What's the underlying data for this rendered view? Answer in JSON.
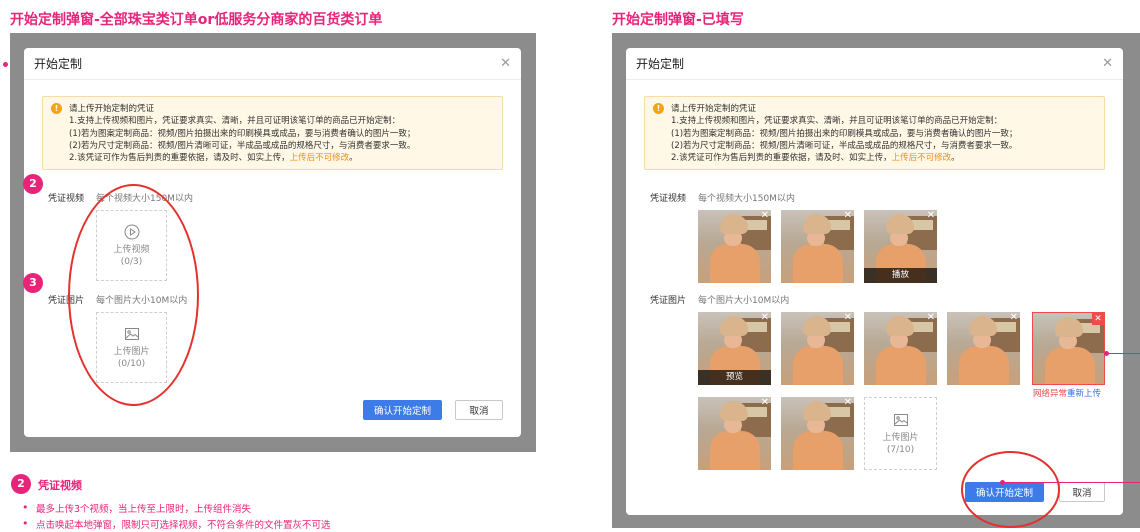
{
  "left_section": {
    "title": "开始定制弹窗-全部珠宝类订单or低服务分商家的百货类订单",
    "modal": {
      "title": "开始定制",
      "notice": {
        "title": "请上传开始定制的凭证",
        "line1": "1.支持上传视频和图片，凭证要求真实、清晰，并且可证明该笔订单的商品已开始定制：",
        "line2": "(1)若为图案定制商品：视频/图片拍摄出来的印刷模具或成品，要与消费者确认的图片一致；",
        "line3": "(2)若为尺寸定制商品：视频/图片清晰可证，半成品或成品的规格尺寸，与消费者要求一致。",
        "line4_prefix": "2.该凭证可作为售后判责的重要依据，请及时、如实上传，",
        "line4_highlight": "上传后不可修改",
        "line4_suffix": "。"
      },
      "video_label": "凭证视频",
      "video_hint": "每个视频大小150M以内",
      "video_upload_label": "上传视频",
      "video_upload_count": "(0/3)",
      "image_label": "凭证图片",
      "image_hint": "每个图片大小10M以内",
      "image_upload_label": "上传图片",
      "image_upload_count": "(0/10)",
      "confirm_label": "确认开始定制",
      "cancel_label": "取消"
    },
    "badge_2": "2",
    "badge_3": "3"
  },
  "right_section": {
    "title": "开始定制弹窗-已填写",
    "modal": {
      "title": "开始定制",
      "notice": {
        "title": "请上传开始定制的凭证",
        "line1": "1.支持上传视频和图片，凭证要求真实、清晰，并且可证明该笔订单的商品已开始定制：",
        "line2": "(1)若为图案定制商品：视频/图片拍摄出来的印刷模具或成品，要与消费者确认的图片一致；",
        "line3": "(2)若为尺寸定制商品：视频/图片清晰可证，半成品或成品的规格尺寸，与消费者要求一致。",
        "line4_prefix": "2.该凭证可作为售后判责的重要依据，请及时、如实上传，",
        "line4_highlight": "上传后不可修改",
        "line4_suffix": "。"
      },
      "video_label": "凭证视频",
      "video_hint": "每个视频大小150M以内",
      "play_caption": "播放",
      "image_label": "凭证图片",
      "image_hint": "每个图片大小10M以内",
      "preview_caption": "预览",
      "error_text_red": "网络异常",
      "error_text_blue": "重新上传",
      "image_upload_label": "上传图片",
      "image_upload_count": "(7/10)",
      "confirm_label": "确认开始定制",
      "cancel_label": "取消"
    }
  },
  "bottom_notes": {
    "badge": "2",
    "title": "凭证视频",
    "bullet1": "最多上传3个视频，当上传至上限时，上传组件消失",
    "bullet2": "点击唤起本地弹窗，限制只可选择视频，不符合条件的文件置灰不可选"
  },
  "colors": {
    "accent_pink": "#e8247a",
    "primary_blue": "#3d7ce8",
    "warning_orange": "#f08c14",
    "error_red": "#f04b4b",
    "backdrop_gray": "#8c8c8c"
  },
  "icons": [
    "close-icon",
    "warning-icon",
    "play-circle-icon",
    "image-icon"
  ]
}
